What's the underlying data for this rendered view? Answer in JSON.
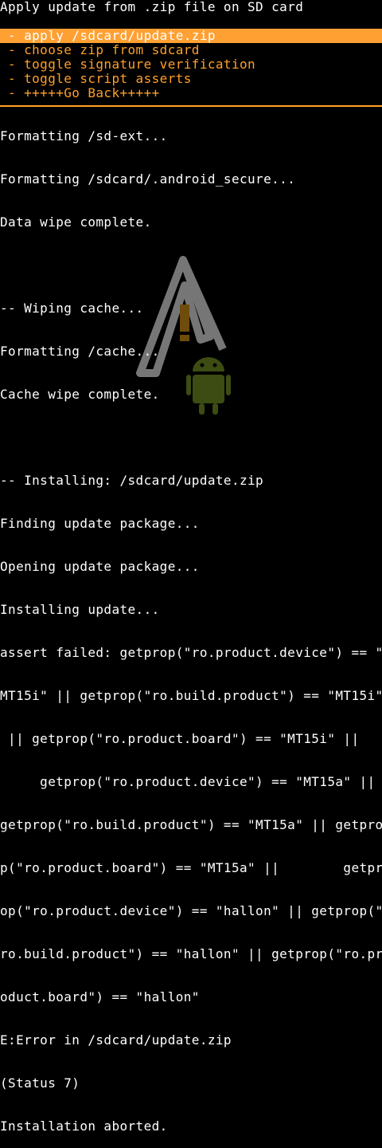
{
  "title": "Apply update from .zip file on SD card",
  "menu": {
    "items": [
      {
        "label": " - apply /sdcard/update.zip",
        "selected": true
      },
      {
        "label": " - choose zip from sdcard",
        "selected": false
      },
      {
        "label": " - toggle signature verification",
        "selected": false
      },
      {
        "label": " - toggle script asserts",
        "selected": false
      },
      {
        "label": " - +++++Go Back+++++",
        "selected": false
      }
    ]
  },
  "log": {
    "lines": [
      "Formatting /sd-ext...",
      "Formatting /sdcard/.android_secure...",
      "Data wipe complete.",
      "",
      "-- Wiping cache...",
      "Formatting /cache...",
      "Cache wipe complete.",
      "",
      "-- Installing: /sdcard/update.zip",
      "Finding update package...",
      "Opening update package...",
      "Installing update...",
      "assert failed: getprop(\"ro.product.device\") == \"",
      "MT15i\" || getprop(\"ro.build.product\") == \"MT15i\"",
      " || getprop(\"ro.product.board\") == \"MT15i\" ||",
      "     getprop(\"ro.product.device\") == \"MT15a\" ||",
      "getprop(\"ro.build.product\") == \"MT15a\" || getpro",
      "p(\"ro.product.board\") == \"MT15a\" ||        getpr",
      "op(\"ro.product.device\") == \"hallon\" || getprop(\"",
      "ro.build.product\") == \"hallon\" || getprop(\"ro.pr",
      "oduct.board\") == \"hallon\"",
      "E:Error in /sdcard/update.zip",
      "(Status 7)",
      "Installation aborted."
    ]
  },
  "background_icon": "android-warning-icon",
  "colors": {
    "background": "#000000",
    "text": "#ffffff",
    "menu_text": "#ff9f2b",
    "menu_highlight": "#ffa033"
  }
}
